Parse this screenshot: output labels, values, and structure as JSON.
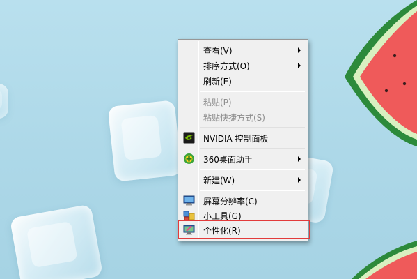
{
  "desktop": {
    "wallpaper": "ice cubes and watermelon on light blue",
    "background_color": "#b3dcea"
  },
  "context_menu": {
    "items": [
      {
        "label": "查看(V)",
        "has_submenu": true
      },
      {
        "label": "排序方式(O)",
        "has_submenu": true
      },
      {
        "label": "刷新(E)"
      },
      {
        "label": "粘贴(P)",
        "disabled": true
      },
      {
        "label": "粘贴快捷方式(S)",
        "disabled": true
      },
      {
        "label": "NVIDIA 控制面板",
        "icon": "nvidia-icon"
      },
      {
        "label": "360桌面助手",
        "icon": "360-icon",
        "has_submenu": true
      },
      {
        "label": "新建(W)",
        "has_submenu": true
      },
      {
        "label": "屏幕分辨率(C)",
        "icon": "screen-resolution-icon"
      },
      {
        "label": "小工具(G)",
        "icon": "gadgets-icon"
      },
      {
        "label": "个性化(R)",
        "icon": "personalize-icon",
        "highlighted": true
      }
    ]
  },
  "highlight_color": "#e23b3b"
}
